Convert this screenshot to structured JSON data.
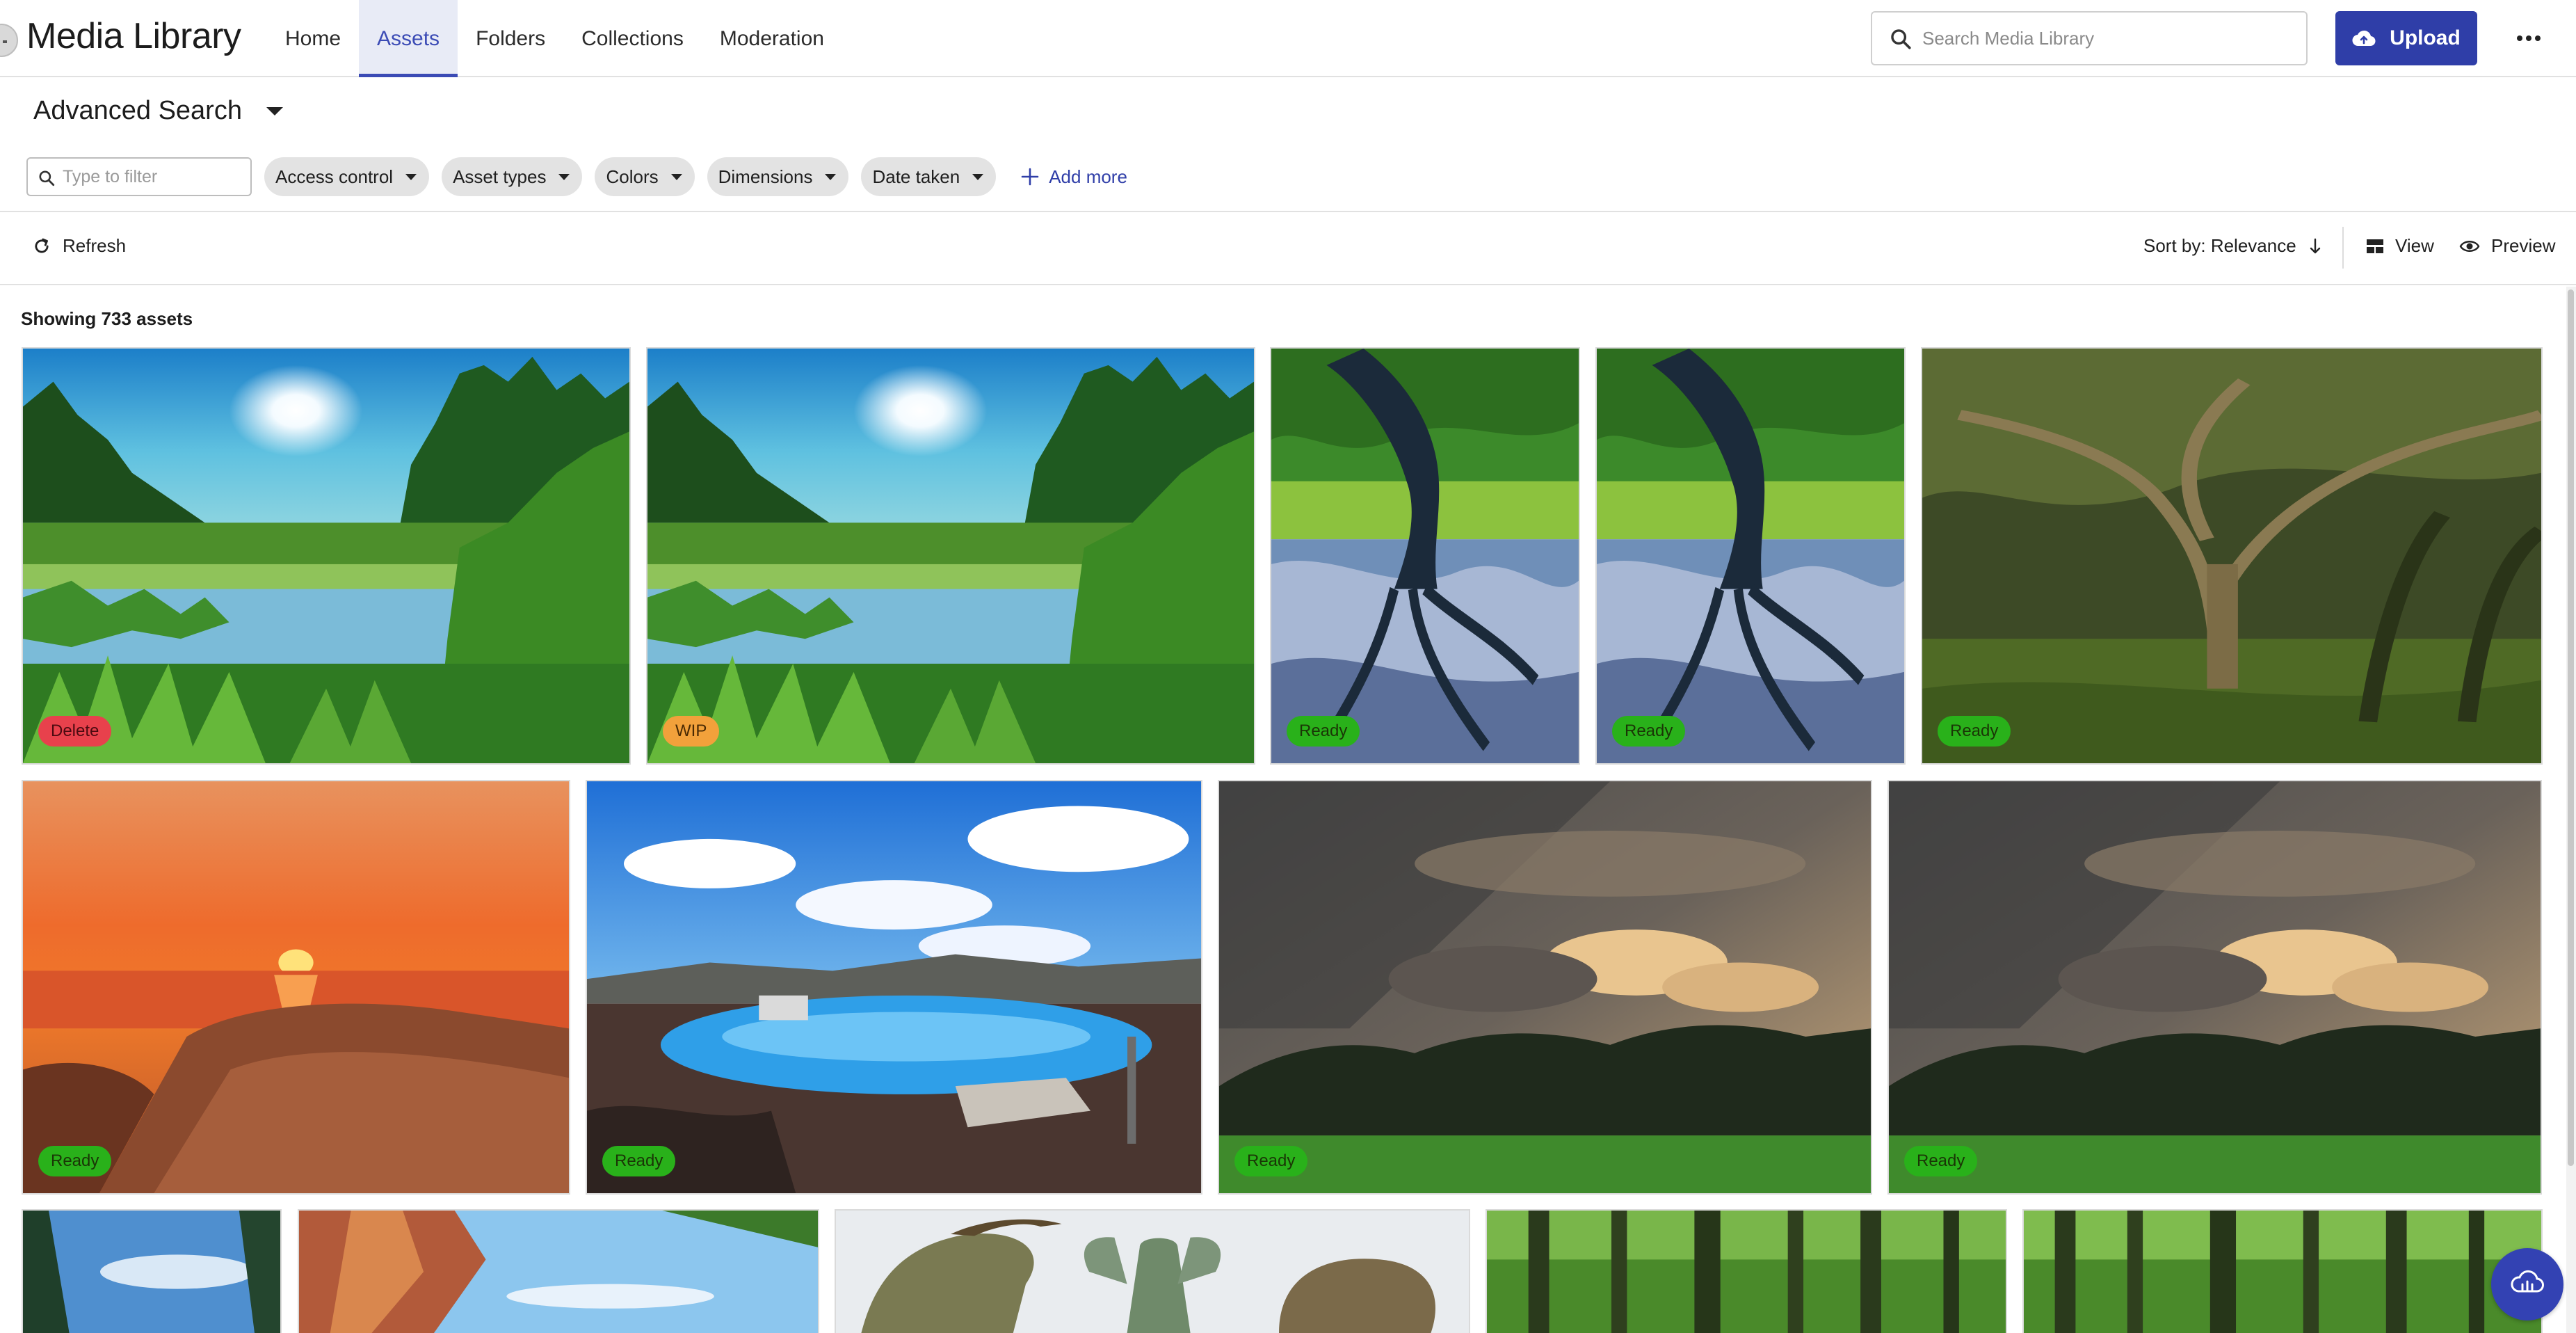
{
  "app": {
    "title": "Media Library"
  },
  "nav": {
    "tabs": [
      {
        "label": "Home",
        "active": false
      },
      {
        "label": "Assets",
        "active": true
      },
      {
        "label": "Folders",
        "active": false
      },
      {
        "label": "Collections",
        "active": false
      },
      {
        "label": "Moderation",
        "active": false
      }
    ]
  },
  "search": {
    "placeholder": "Search Media Library",
    "icon": "search-icon"
  },
  "upload": {
    "label": "Upload",
    "icon": "cloud-upload-icon"
  },
  "more": {
    "icon": "more-horizontal-icon"
  },
  "advanced_search": {
    "title": "Advanced Search",
    "filter_placeholder": "Type to filter",
    "filters": [
      "Access control",
      "Asset types",
      "Colors",
      "Dimensions",
      "Date taken"
    ],
    "add_more_label": "Add more"
  },
  "toolbar": {
    "refresh_label": "Refresh",
    "sort_label": "Sort by: Relevance",
    "view_label": "View",
    "preview_label": "Preview"
  },
  "results": {
    "count_text": "Showing 733 assets"
  },
  "colors": {
    "accent": "#2f3ea8",
    "active_tab_bg": "#e8ebf6",
    "badge_ready": "#29b11a",
    "badge_delete": "#e8414c",
    "badge_wip": "#f2a13b"
  },
  "assets": [
    {
      "status": "Delete",
      "subject": "lake-sun-forest"
    },
    {
      "status": "WIP",
      "subject": "lake-sun-forest"
    },
    {
      "status": "Ready",
      "subject": "tree-reflection"
    },
    {
      "status": "Ready",
      "subject": "tree-reflection"
    },
    {
      "status": "Ready",
      "subject": "mossy-oak-forest"
    },
    {
      "status": "Ready",
      "subject": "orange-sunset-shore"
    },
    {
      "status": "Ready",
      "subject": "blue-lagoon-pool"
    },
    {
      "status": "Ready",
      "subject": "storm-clouds-trees"
    },
    {
      "status": "Ready",
      "subject": "storm-clouds-trees"
    },
    {
      "status": "",
      "subject": "pine-sky"
    },
    {
      "status": "",
      "subject": "red-canyon"
    },
    {
      "status": "",
      "subject": "cactus-figures"
    },
    {
      "status": "",
      "subject": "tall-forest"
    },
    {
      "status": "",
      "subject": "tall-forest"
    }
  ]
}
